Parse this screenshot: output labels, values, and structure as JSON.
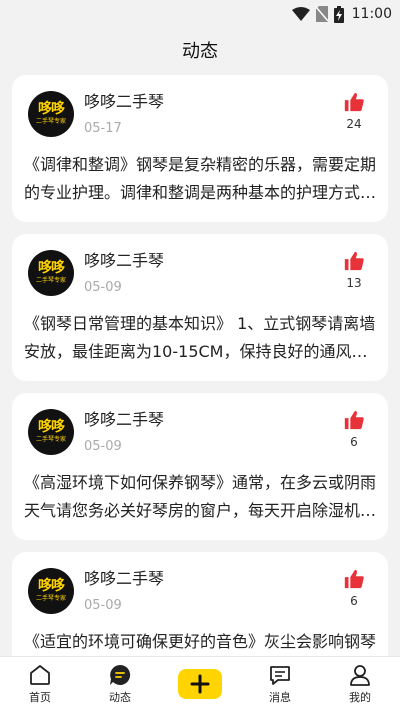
{
  "status_bar": {
    "time": "11:00"
  },
  "header": {
    "title": "动态"
  },
  "posts": [
    {
      "author": "哆哆二手琴",
      "date": "05-17",
      "likes": "24",
      "content": "《调律和整调》钢琴是复杂精密的乐器，需要定期的专业护理。调律和整调是两种基本的护理方式…"
    },
    {
      "author": "哆哆二手琴",
      "date": "05-09",
      "likes": "13",
      "content": "《钢琴日常管理的基本知识》 1、立式钢琴请离墙安放，最佳距离为10-15CM，保持良好的通风…"
    },
    {
      "author": "哆哆二手琴",
      "date": "05-09",
      "likes": "6",
      "content": "《高湿环境下如何保养钢琴》通常，在多云或阴雨天气请您务必关好琴房的窗户，每天开启除湿机…"
    },
    {
      "author": "哆哆二手琴",
      "date": "05-09",
      "likes": "6",
      "content": "《适宜的环境可确保更好的音色》灰尘会影响钢琴的音色"
    }
  ],
  "avatar_logo": {
    "main": "哆哆",
    "sub": "二手琴专家"
  },
  "tabbar": {
    "home": "首页",
    "feed": "动态",
    "messages": "消息",
    "mine": "我的"
  },
  "colors": {
    "accent": "#ffd400",
    "like": "#e8323a"
  }
}
